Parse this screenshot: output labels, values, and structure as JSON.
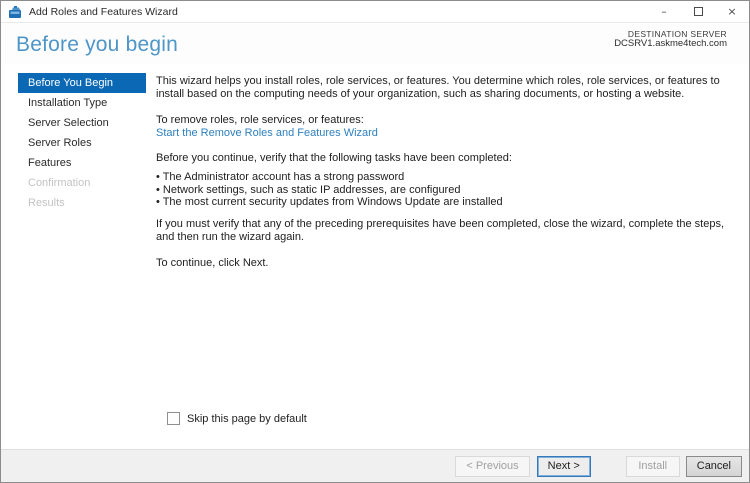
{
  "window": {
    "title": "Add Roles and Features Wizard",
    "controls": {
      "minimize_glyph": "–",
      "close_glyph": "×"
    }
  },
  "header": {
    "page_title": "Before you begin",
    "destination_label": "DESTINATION SERVER",
    "destination_server": "DCSRV1.askme4tech.com"
  },
  "sidebar": {
    "items": [
      {
        "label": "Before You Begin",
        "state": "active"
      },
      {
        "label": "Installation Type",
        "state": "enabled"
      },
      {
        "label": "Server Selection",
        "state": "enabled"
      },
      {
        "label": "Server Roles",
        "state": "enabled"
      },
      {
        "label": "Features",
        "state": "enabled"
      },
      {
        "label": "Confirmation",
        "state": "disabled"
      },
      {
        "label": "Results",
        "state": "disabled"
      }
    ]
  },
  "content": {
    "intro": "This wizard helps you install roles, role services, or features. You determine which roles, role services, or features to install based on the computing needs of your organization, such as sharing documents, or hosting a website.",
    "remove_lead": "To remove roles, role services, or features:",
    "remove_link": "Start the Remove Roles and Features Wizard",
    "verify_lead": "Before you continue, verify that the following tasks have been completed:",
    "bullets": [
      "• The Administrator account has a strong password",
      "• Network settings, such as static IP addresses, are configured",
      "• The most current security updates from Windows Update are installed"
    ],
    "rerun_note": "If you must verify that any of the preceding prerequisites have been completed, close the wizard, complete the steps, and then run the wizard again.",
    "continue_note": "To continue, click Next."
  },
  "footer": {
    "skip_label": "Skip this page by default",
    "buttons": {
      "previous": "< Previous",
      "next": "Next >",
      "install": "Install",
      "cancel": "Cancel"
    }
  },
  "colors": {
    "nav_selected_bg": "#0a68b4",
    "page_title": "#4e95c8",
    "link": "#2e7fbe",
    "footer_bg": "#f0f0f0",
    "default_button_border": "#3579b8"
  }
}
